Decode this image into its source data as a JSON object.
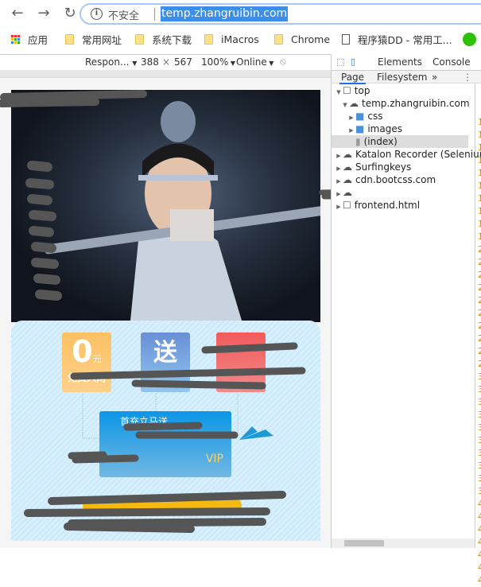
{
  "browser": {
    "nav": {
      "back": "back-arrow-icon",
      "forward": "forward-arrow-icon",
      "reload": "reload-icon"
    },
    "omnibox": {
      "security_label": "不安全",
      "url": "temp.zhangruibin.com"
    },
    "bookmarks": [
      {
        "label": "应用",
        "icon": "apps-grid-icon"
      },
      {
        "label": "常用网址",
        "icon": "folder-icon"
      },
      {
        "label": "系统下载",
        "icon": "folder-icon"
      },
      {
        "label": "iMacros",
        "icon": "folder-icon"
      },
      {
        "label": "Chrome",
        "icon": "folder-icon"
      },
      {
        "label": "程序猿DD - 常用工...",
        "icon": "page-icon"
      }
    ]
  },
  "device_toolbar": {
    "device": "Respon...",
    "width": "388",
    "times": "×",
    "height": "567",
    "zoom": "100%",
    "network": "Online"
  },
  "page": {
    "tiles": [
      {
        "big": "0",
        "small": "元",
        "caption": "免费入网",
        "color": "#fcc162"
      },
      {
        "big": "送",
        "color": "#6a8fd6"
      },
      {
        "color": "#f25a5a"
      }
    ],
    "card": {
      "title": "首充立马送",
      "vip": "VIP"
    }
  },
  "devtools": {
    "tabs": [
      "Elements",
      "Console"
    ],
    "subtabs": [
      "Page",
      "Filesystem",
      "»"
    ],
    "tree": [
      {
        "label": "top",
        "depth": 0,
        "icon": "frame-icon",
        "expanded": true
      },
      {
        "label": "temp.zhangruibin.com",
        "depth": 1,
        "icon": "cloud-icon",
        "expanded": true
      },
      {
        "label": "css",
        "depth": 2,
        "icon": "folder-icon",
        "expanded": false
      },
      {
        "label": "images",
        "depth": 2,
        "icon": "folder-icon",
        "expanded": false
      },
      {
        "label": "(index)",
        "depth": 2,
        "icon": "file-icon",
        "selected": true
      },
      {
        "label": "Katalon Recorder (Selenium",
        "depth": 0,
        "icon": "cloud-icon",
        "expanded": false
      },
      {
        "label": "Surfingkeys",
        "depth": 0,
        "icon": "cloud-icon",
        "expanded": false
      },
      {
        "label": "cdn.bootcss.com",
        "depth": 0,
        "icon": "cloud-icon",
        "expanded": false
      },
      {
        "label": "",
        "depth": 0,
        "icon": "cloud-icon",
        "expanded": false
      },
      {
        "label": "frontend.html",
        "depth": 0,
        "icon": "frame-icon",
        "expanded": false
      }
    ],
    "line_digits": [
      "1",
      "1",
      "1",
      "1",
      "1",
      "1",
      "1",
      "1",
      "1",
      "1",
      "2",
      "2",
      "2",
      "2",
      "2",
      "2",
      "2",
      "2",
      "2",
      "2",
      "3",
      "3",
      "3",
      "3",
      "3",
      "3",
      "3",
      "3",
      "3",
      "3",
      "4",
      "4",
      "4",
      "4",
      "4",
      "4",
      "4"
    ]
  }
}
